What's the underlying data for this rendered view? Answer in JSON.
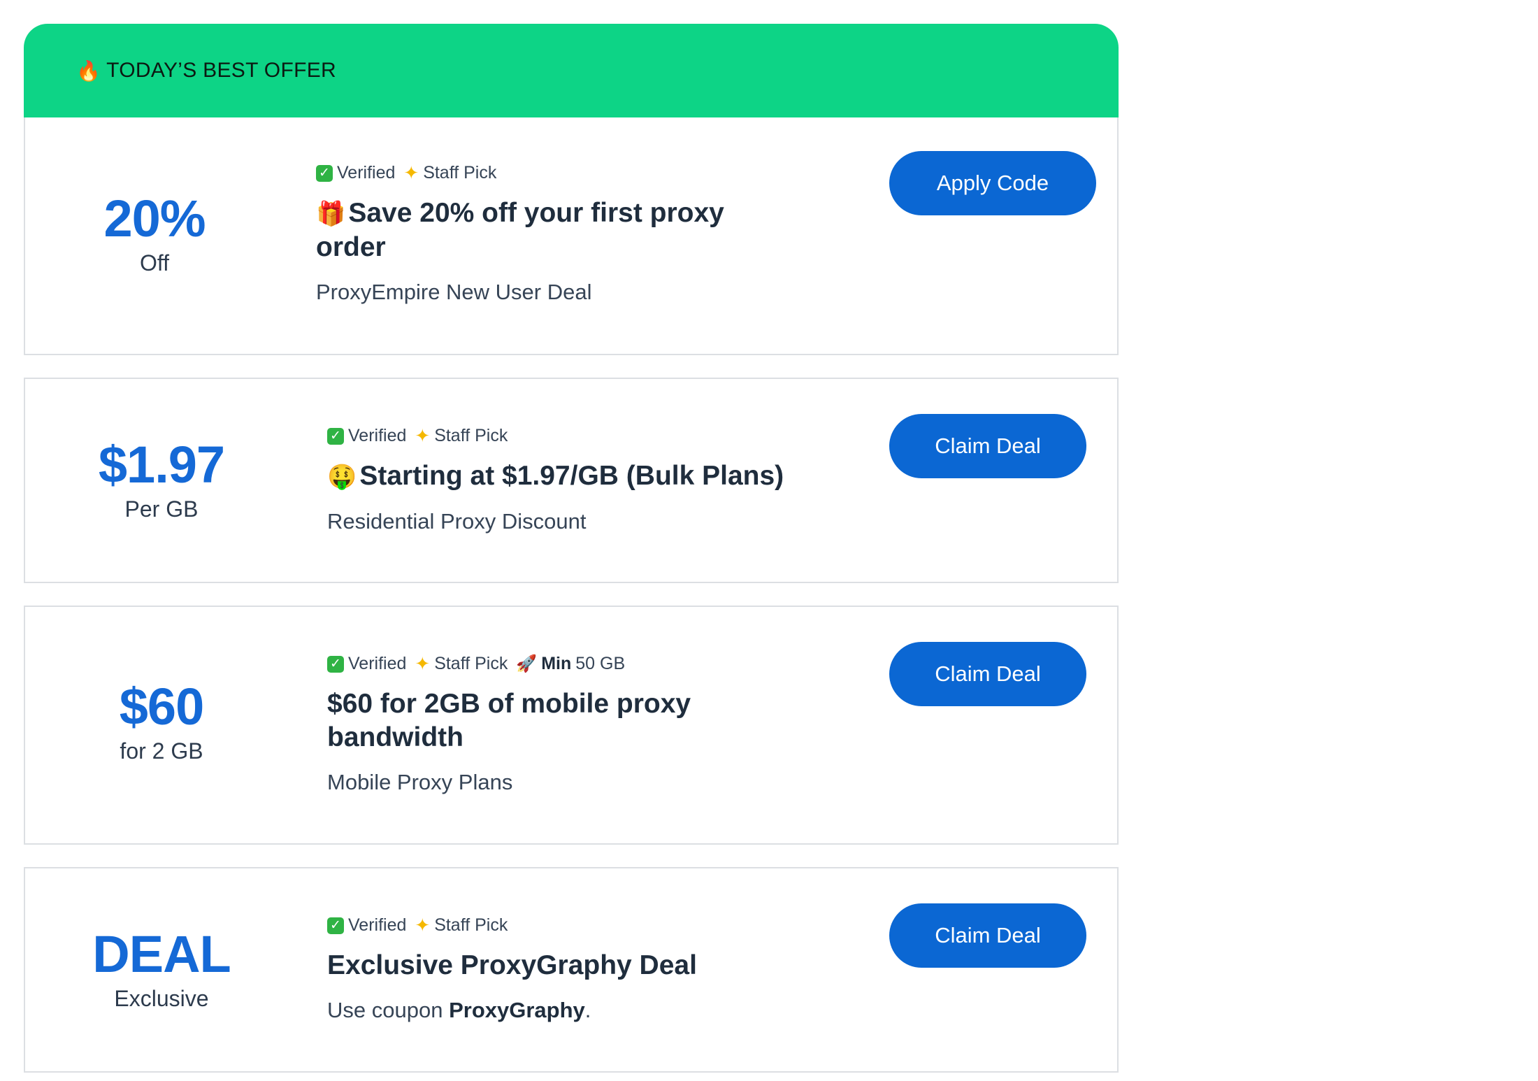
{
  "banner": {
    "icon": "fire-icon",
    "label": "TODAY’S BEST OFFER"
  },
  "colors": {
    "banner": "#0dd486",
    "accent": "#1569d6",
    "button": "#0b67d3"
  },
  "offers": [
    {
      "big": "20%",
      "unit": "Off",
      "verified": "Verified",
      "staff": "Staff Pick",
      "title": "Save 20% off your first proxy order",
      "title_icon": "gift-icon",
      "subtitle": "ProxyEmpire New User Deal",
      "button": "Apply Code"
    },
    {
      "big": "$1.97",
      "unit": "Per GB",
      "verified": "Verified",
      "staff": "Staff Pick",
      "title": "Starting at $1.97/GB (Bulk Plans)",
      "title_icon": "money-mouth-face-icon",
      "subtitle": "Residential Proxy Discount",
      "button": "Claim Deal"
    },
    {
      "big": "$60",
      "unit": "for 2 GB",
      "verified": "Verified",
      "staff": "Staff Pick",
      "min_label": "Min",
      "min_value": "50 GB",
      "title": "$60 for 2GB of mobile proxy bandwidth",
      "subtitle": "Mobile Proxy Plans",
      "button": "Claim Deal"
    },
    {
      "big": "DEAL",
      "unit": "Exclusive",
      "verified": "Verified",
      "staff": "Staff Pick",
      "title": "Exclusive ProxyGraphy Deal",
      "subtitle_prefix": "Use coupon",
      "subtitle_code": "ProxyGraphy",
      "subtitle_suffix": ".",
      "button": "Claim Deal"
    }
  ]
}
